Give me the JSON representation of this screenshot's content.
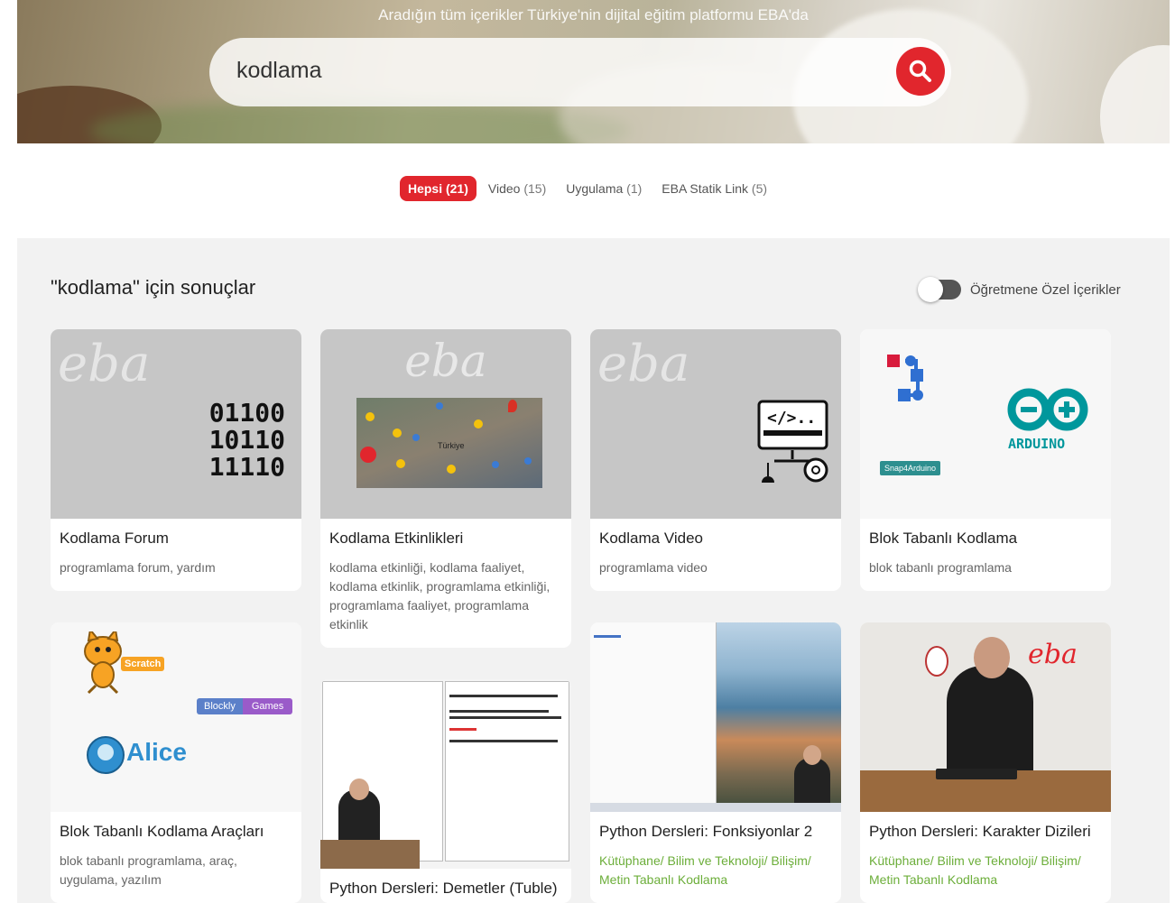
{
  "hero": {
    "tagline": "Aradığın tüm içerikler Türkiye'nin dijital eğitim platformu EBA'da",
    "search_value": "kodlama"
  },
  "tabs": [
    {
      "label": "Hepsi",
      "count": "(21)",
      "active": true
    },
    {
      "label": "Video",
      "count": "(15)",
      "active": false
    },
    {
      "label": "Uygulama",
      "count": "(1)",
      "active": false
    },
    {
      "label": "EBA Statik Link",
      "count": "(5)",
      "active": false
    }
  ],
  "results": {
    "title": "\"kodlama\" için sonuçlar",
    "toggle_label": "Öğretmene Özel İçerikler",
    "cards": [
      {
        "title": "Kodlama Forum",
        "desc": "programlama forum, yardım"
      },
      {
        "title": "Kodlama Etkinlikleri",
        "desc": "kodlama etkinliği, kodlama faaliyet, kodlama etkinlik, programlama etkinliği, programlama faaliyet, programlama etkinlik"
      },
      {
        "title": "Kodlama Video",
        "desc": "programlama video"
      },
      {
        "title": "Blok Tabanlı Kodlama",
        "desc": "blok tabanlı programlama"
      },
      {
        "title": "Blok Tabanlı Kodlama Araçları",
        "desc": "blok tabanlı programlama, araç, uygulama, yazılım"
      },
      {
        "title": "Python Dersleri: Demetler (Tuble)",
        "desc": ""
      },
      {
        "title": "Python Dersleri: Fonksiyonlar 2",
        "desc": "Kütüphane/ Bilim ve Teknoloji/ Bilişim/ Metin Tabanlı Kodlama"
      },
      {
        "title": "Python Dersleri: Karakter Dizileri",
        "desc": "Kütüphane/ Bilim ve Teknoloji/ Bilişim/ Metin Tabanlı Kodlama"
      }
    ]
  },
  "thumbs": {
    "eba_logo": "eba",
    "binary_lines": [
      "01100",
      "10110",
      "11110"
    ],
    "code_symbol": "</>..",
    "arduino_label": "ARDUINO",
    "snap_label": "Snap4Arduino",
    "scratch_label": "Scratch",
    "blockly_label": "Blockly",
    "games_label": "Games",
    "alice_label": "Alice",
    "map_country": "Türkiye"
  },
  "colors": {
    "accent": "#e1262d",
    "green_tag": "#6cae3a",
    "arduino": "#00979c"
  }
}
